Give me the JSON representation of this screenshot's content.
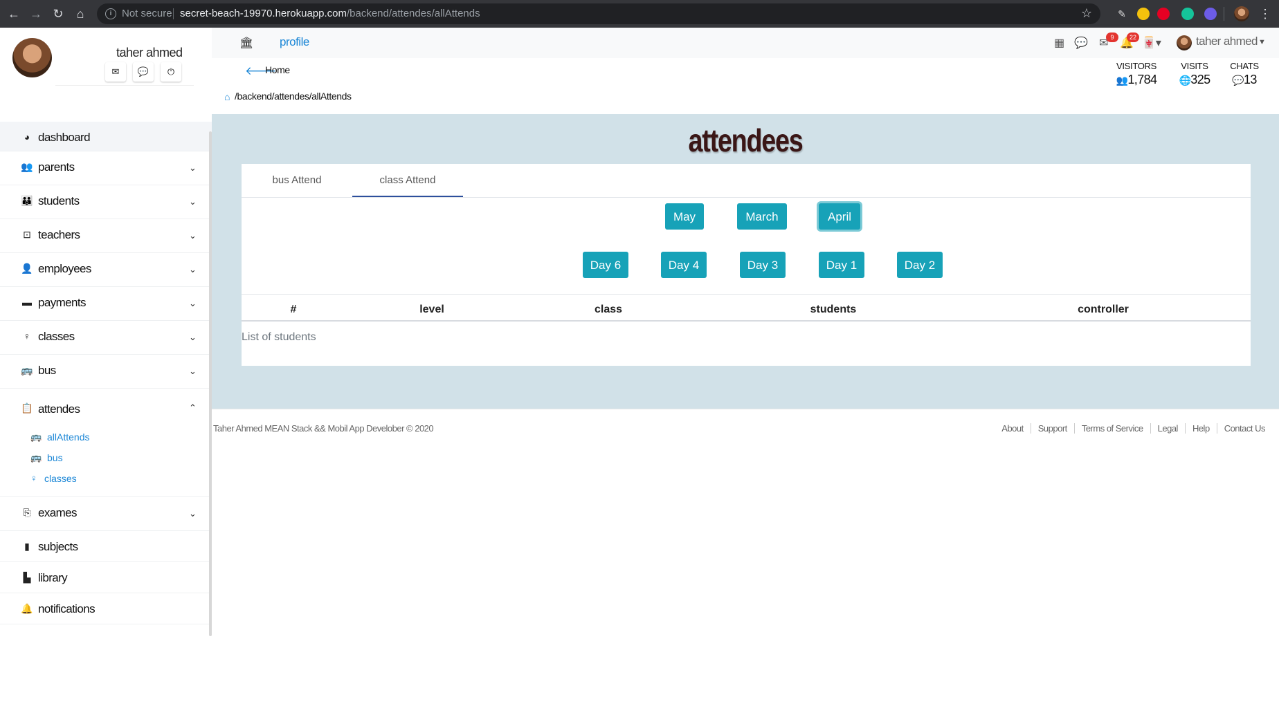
{
  "browser": {
    "security": "Not secure",
    "url_host": "secret-beach-19970.herokuapp.com",
    "url_path": "/backend/attendes/allAttends"
  },
  "sidebar": {
    "username": "taher ahmed",
    "items": [
      {
        "label": "dashboard",
        "icon": "dashboard-icon"
      },
      {
        "label": "parents",
        "icon": "users-icon"
      },
      {
        "label": "students",
        "icon": "child-icon"
      },
      {
        "label": "teachers",
        "icon": "chalkboard-teacher-icon"
      },
      {
        "label": "employees",
        "icon": "user-icon"
      },
      {
        "label": "payments",
        "icon": "wallet-icon"
      },
      {
        "label": "classes",
        "icon": "lightbulb-icon"
      },
      {
        "label": "bus",
        "icon": "bus-icon"
      },
      {
        "label": "attendes",
        "icon": "clipboard-icon"
      },
      {
        "label": "exames",
        "icon": "file-export-icon"
      },
      {
        "label": "subjects",
        "icon": "book-icon"
      },
      {
        "label": "library",
        "icon": "books-icon"
      },
      {
        "label": "notifications",
        "icon": "bell-icon"
      }
    ],
    "subitems": [
      {
        "label": "allAttends",
        "icon": "bus-icon"
      },
      {
        "label": "bus",
        "icon": "bus-icon"
      },
      {
        "label": "classes",
        "icon": "lightbulb-icon"
      }
    ]
  },
  "header": {
    "profile": "profile",
    "messages_badge": "9",
    "notifications_badge": "22",
    "user": "taher ahmed"
  },
  "breadcrumb": {
    "back_label": "Home",
    "path": "/backend/attendes/allAttends"
  },
  "stats": [
    {
      "label": "VISITORS",
      "value": "1,784",
      "icon": "users-icon"
    },
    {
      "label": "VISITS",
      "value": "325",
      "icon": "globe-icon"
    },
    {
      "label": "CHATS",
      "value": "13",
      "icon": "comments-icon"
    }
  ],
  "main": {
    "title": "attendees",
    "tabs": [
      "bus Attend",
      "class Attend"
    ],
    "active_tab": "class Attend",
    "months": [
      "May",
      "March",
      "April"
    ],
    "selected_month": "April",
    "days": [
      "Day 6",
      "Day 4",
      "Day 3",
      "Day 1",
      "Day 2"
    ],
    "table_headers": [
      "#",
      "level",
      "class",
      "students",
      "controller"
    ],
    "table_caption": "List of students"
  },
  "footer": {
    "text": "Taher Ahmed MEAN Stack && Mobil App Develober © 2020",
    "links": [
      "About",
      "Support",
      "Terms of Service",
      "Legal",
      "Help",
      "Contact Us"
    ]
  },
  "colors": {
    "primary_button": "#17a2b8",
    "link": "#1a86d6",
    "content_bg": "#d1e1e8",
    "title": "#3a1616"
  }
}
